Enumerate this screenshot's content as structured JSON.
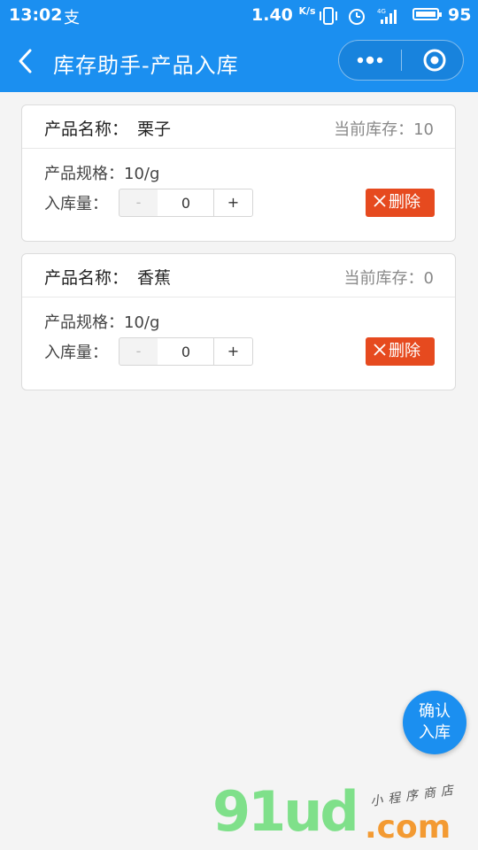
{
  "status_bar": {
    "time": "13:02",
    "extra_glyph": "支",
    "net_speed": "1.40",
    "net_speed_unit": "K/s",
    "network": "4G",
    "battery_level": "95"
  },
  "nav": {
    "title": "库存助手-产品入库",
    "back_icon": "chevron-left-icon",
    "more_icon": "more-dots-icon",
    "close_icon": "target-circle-icon"
  },
  "products": [
    {
      "name_label": "产品名称：",
      "name": "栗子",
      "stock_text": "当前库存：10",
      "spec_text": "产品规格：10/g",
      "qty_label": "入库量：",
      "minus": "-",
      "plus": "+",
      "qty_value": "0",
      "delete_label": "删除"
    },
    {
      "name_label": "产品名称：",
      "name": "香蕉",
      "stock_text": "当前库存：0",
      "spec_text": "产品规格：10/g",
      "qty_label": "入库量：",
      "minus": "-",
      "plus": "+",
      "qty_value": "0",
      "delete_label": "删除"
    }
  ],
  "confirm_button": {
    "line1": "确认",
    "line2": "入库"
  },
  "watermark": {
    "logo": "91ud",
    "domain": ".com",
    "tagline": "小程序商店"
  },
  "colors": {
    "primary": "#1b8ff0",
    "danger": "#e64a1f"
  }
}
